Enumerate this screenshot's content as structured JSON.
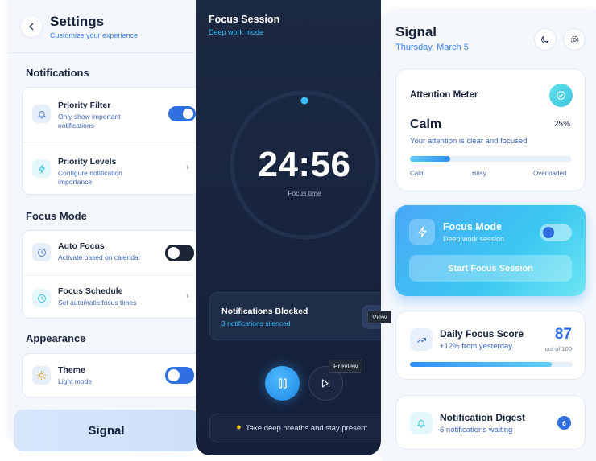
{
  "settings": {
    "title": "Settings",
    "subtitle": "Customize your experience",
    "sections": {
      "notifications": "Notifications",
      "focus_mode": "Focus Mode",
      "appearance": "Appearance"
    },
    "priority_filter": {
      "title": "Priority Filter",
      "desc_line1": "Only show important",
      "desc_line2": "notifications",
      "toggle_on": true
    },
    "priority_levels": {
      "title": "Priority Levels",
      "desc_line1": "Configure notification",
      "desc_line2": "importance"
    },
    "auto_focus": {
      "title": "Auto Focus",
      "desc": "Activate based on calendar",
      "toggle_on": false
    },
    "focus_schedule": {
      "title": "Focus Schedule",
      "desc": "Set automatic focus times"
    },
    "theme": {
      "title": "Theme",
      "desc": "Light mode",
      "toggle_on": false
    },
    "signal_button": "Signal"
  },
  "focus_session": {
    "title": "Focus Session",
    "subtitle": "Deep work mode",
    "timer": "24:56",
    "timer_label": "Focus time",
    "blocked": {
      "title": "Notifications Blocked",
      "subtitle": "3 notifications silenced",
      "view_tooltip": "View"
    },
    "preview_tooltip": "Preview",
    "tip": "Take deep breaths and stay present"
  },
  "signal": {
    "title": "Signal",
    "date": "Thursday, March 5",
    "attention_meter": {
      "title": "Attention Meter",
      "state": "Calm",
      "percent_label": "25%",
      "percent": 25,
      "description": "Your attention is clear and focused",
      "scale": [
        "Calm",
        "Busy",
        "Overloaded"
      ]
    },
    "focus_mode": {
      "title": "Focus Mode",
      "subtitle": "Deep work session",
      "toggle_on": false,
      "start_button": "Start Focus Session"
    },
    "daily_score": {
      "title": "Daily Focus Score",
      "subtitle": "+12% from yesterday",
      "score": "87",
      "out_of": "out of 100",
      "fraction": 0.87
    },
    "digest": {
      "title": "Notification Digest",
      "subtitle": "6 notifications waiting",
      "count": "6"
    }
  },
  "icons": [
    "back-chevron-icon",
    "bell-icon",
    "lightning-icon",
    "clock-icon",
    "sun-icon",
    "chevron-right-icon",
    "pause-icon",
    "skip-next-icon",
    "lightbulb-icon",
    "moon-icon",
    "gear-icon",
    "check-icon",
    "trend-up-icon"
  ],
  "colors": {
    "accent": "#3b82f6",
    "dark_panel": "#1c2942",
    "cyan": "#38bdf8"
  }
}
